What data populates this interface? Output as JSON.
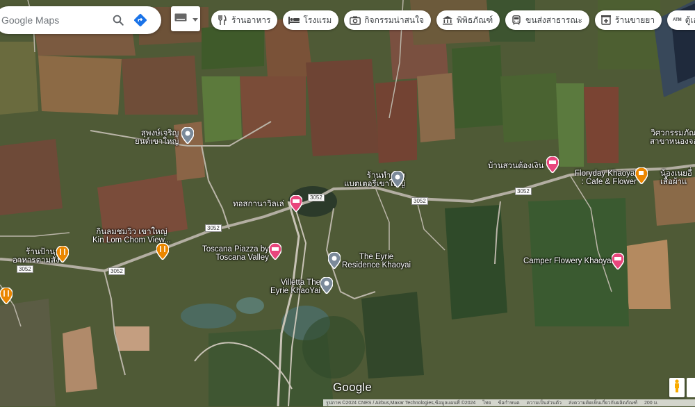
{
  "search": {
    "placeholder": "Google Maps"
  },
  "chips": [
    {
      "label": "ร้านอาหาร",
      "icon": "restaurant-icon"
    },
    {
      "label": "โรงแรม",
      "icon": "hotel-icon"
    },
    {
      "label": "กิจกรรมน่าสนใจ",
      "icon": "camera-icon"
    },
    {
      "label": "พิพิธภัณฑ์",
      "icon": "museum-icon"
    },
    {
      "label": "ขนส่งสาธารณะ",
      "icon": "transit-icon"
    },
    {
      "label": "ร้านขายยา",
      "icon": "pharmacy-icon"
    },
    {
      "label": "ตู้เอทีเอ็ม",
      "icon": "atm-icon"
    }
  ],
  "places": {
    "sompong_line1": "สุพงษ์เจริญ",
    "sompong_line2": "ยนต์เขาใหญ่",
    "battery_line1": "ร้านทำแหง",
    "battery_line2": "แบตเตอรี่เขาใหญ่",
    "thongsuan_line1": "บ้านสวนต้องเงิน",
    "floryday_line1": "Floryday Khaoyai",
    "floryday_line2": ": Cafe & Flower",
    "museum_line1": "วิศวกรรมภัณฑ์",
    "museum_line2": "สาขาหนองจอก",
    "nong_line1": "น้องเนยอื่",
    "nong_line2": "เสื้อผ้าแ",
    "torsakan": "ทอสกานาวิลเล่",
    "kinlom_line1": "กินลมชมวิว เขาใหญ่",
    "kinlom_line2": "Kin Lom Chom View...",
    "ranamnam_line1": "ร้านป้านา",
    "ranamnam_line2": "อาหารตามสั่ง",
    "toscana_line1": "Toscana Piazza by",
    "toscana_line2": "Toscana Valley",
    "eyrie_line1": "The Eyrie",
    "eyrie_line2": "Residence Khaoyai",
    "villetta_line1": "Villetta The",
    "villetta_line2": "Eyrie KhaoYai",
    "camper": "Camper Flowery Khaoyai"
  },
  "routes": {
    "r1": "3052",
    "r2": "3052",
    "r3": "3052",
    "r4": "3052",
    "r5": "3052"
  },
  "logo": "Google",
  "footer": {
    "imagery": "รูปภาพ ©2024 CNES / Airbus,Maxar Technologies,ข้อมูลแผนที่ ©2024",
    "thai": "ไทย",
    "terms": "ข้อกำหนด",
    "privacy": "ความเป็นส่วนตัว",
    "feedback": "ส่งความคิดเห็นเกี่ยวกับผลิตภัณฑ์",
    "scale": "200 ม."
  },
  "colors": {
    "restaurant_pin": "#ea8600",
    "hotel_pin": "#e8467c",
    "poi_pin": "#7b8a9a",
    "directions": "#1a73e8"
  }
}
